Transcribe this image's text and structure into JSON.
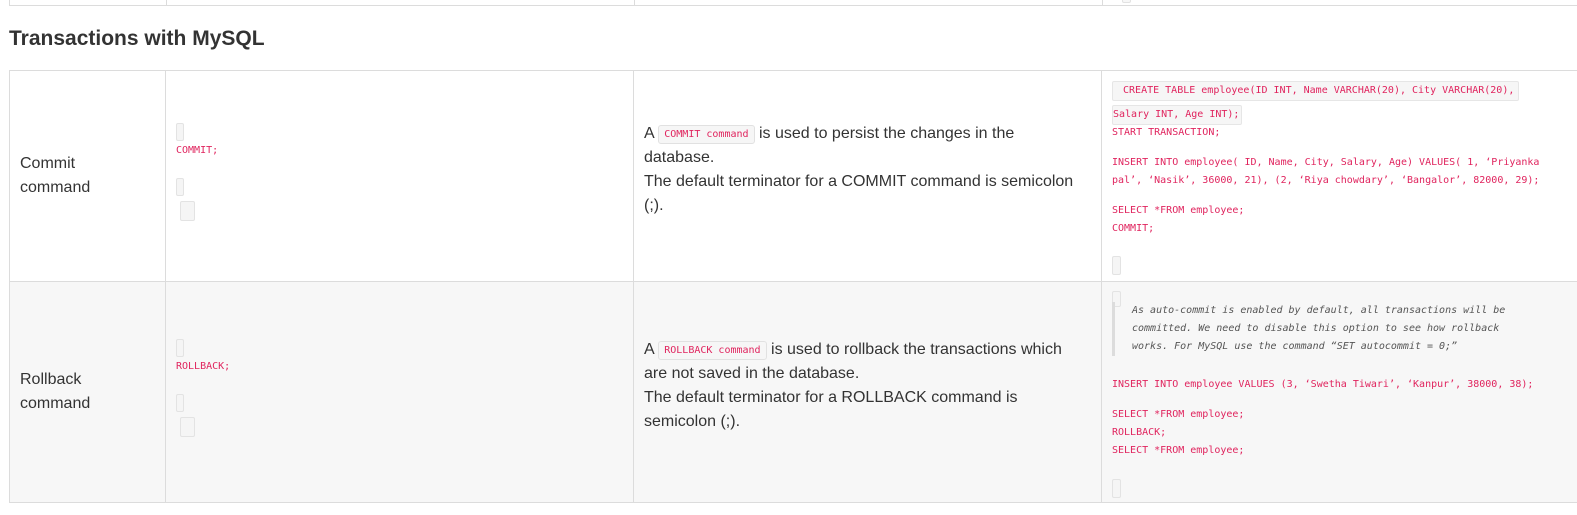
{
  "section": {
    "title": "Transactions with MySQL"
  },
  "rows": [
    {
      "name_line1": "Commit",
      "name_line2": "command",
      "syntax": "COMMIT;",
      "desc_prefix": "A",
      "desc_code": "COMMIT command",
      "desc_line1_rest": "is used to persist the changes in the",
      "desc_line2": "database.",
      "desc_line3": "The default terminator for a COMMIT command is semicolon",
      "desc_line4": "(;).",
      "example": {
        "line1": " CREATE TABLE employee(ID INT, Name VARCHAR(20), City VARCHAR(20),",
        "line2": "Salary INT, Age INT);",
        "line3": "START TRANSACTION;",
        "line4": "INSERT INTO employee( ID, Name, City, Salary, Age) VALUES( 1, ‘Priyanka",
        "line5": "pal’, ‘Nasik’, 36000, 21), (2, ‘Riya chowdary’, ‘Bangalor’, 82000, 29);",
        "line6": "SELECT *FROM employee;",
        "line7": "COMMIT;"
      }
    },
    {
      "name_line1": "Rollback",
      "name_line2": "command",
      "syntax": "ROLLBACK;",
      "desc_prefix": "A",
      "desc_code": "ROLLBACK command",
      "desc_line1_rest": "is used to rollback the transactions which",
      "desc_line2": "are not saved in the database.",
      "desc_line3": "The default terminator for a ROLLBACK command is",
      "desc_line4": "semicolon (;).",
      "example": {
        "note_line1": "As auto-commit is enabled by default, all transactions will be",
        "note_line2": "committed. We need to disable this option to see how rollback",
        "note_line3": "works. For MySQL use the command “SET autocommit = 0;”",
        "line1": "INSERT INTO employee VALUES (3, ‘Swetha Tiwari’, ‘Kanpur’, 38000, 38);",
        "line2": "SELECT *FROM employee;",
        "line3": "ROLLBACK;",
        "line4": "SELECT *FROM employee;"
      }
    }
  ]
}
